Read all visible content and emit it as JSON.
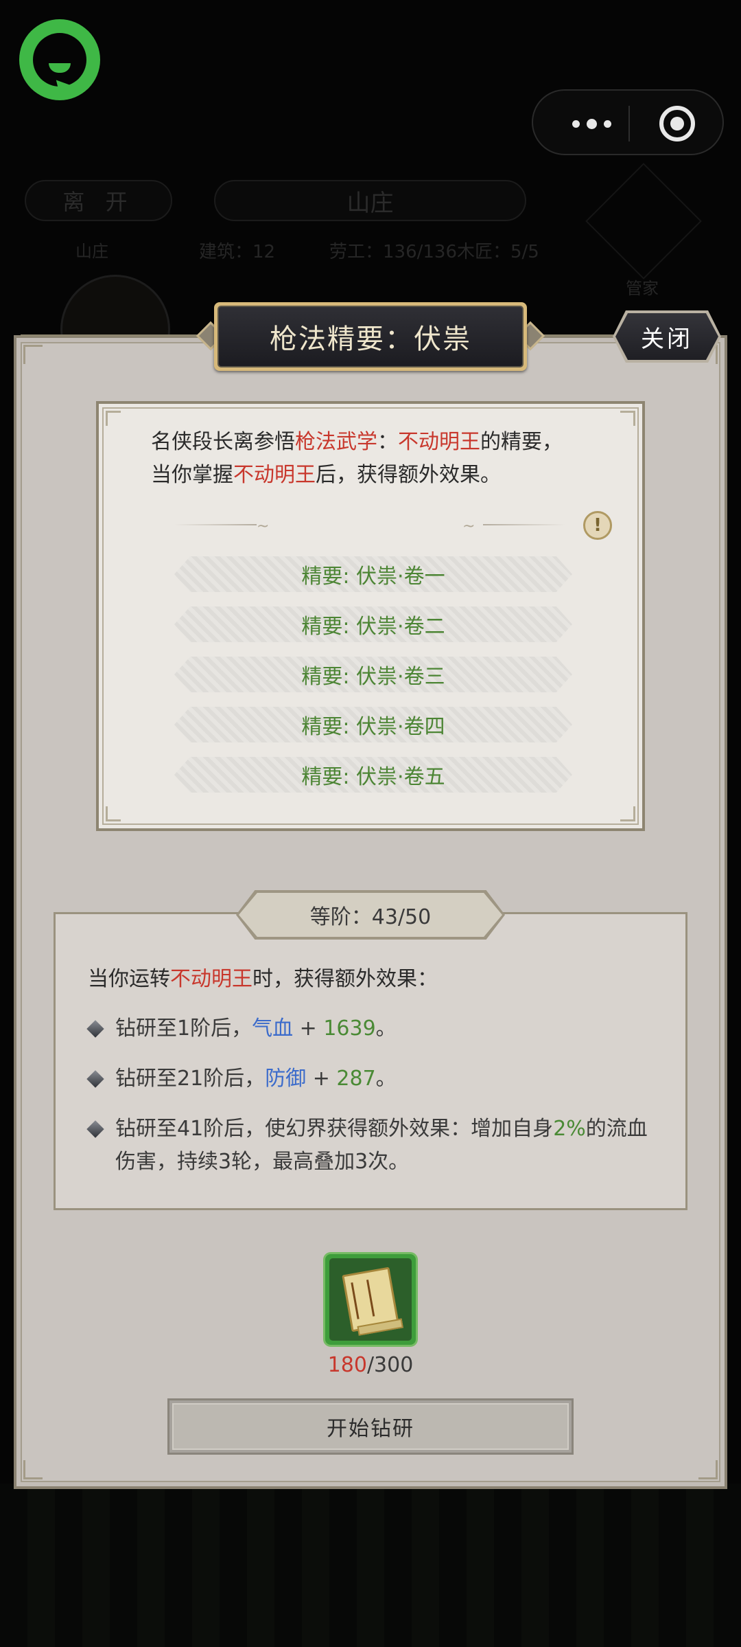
{
  "top": {
    "leave_label": "离 开",
    "manor_label": "山庄",
    "stats": {
      "buildings": "建筑：12",
      "workers": "劳工：136/136",
      "carpenter": "木匠：5/5"
    },
    "steward_label": "管家",
    "left_label": "山庄"
  },
  "dialog": {
    "title": "枪法精要：伏祟",
    "close_label": "关闭"
  },
  "essence": {
    "intro_1": "名侠段长离参悟",
    "intro_2": "枪法武学",
    "intro_3": "：",
    "intro_4": "不动明王",
    "intro_5": "的精要，",
    "intro_6": "当你掌握",
    "intro_7": "不动明王",
    "intro_8": "后，获得额外效果。",
    "volumes": [
      "精要: 伏祟·卷一",
      "精要: 伏祟·卷二",
      "精要: 伏祟·卷三",
      "精要: 伏祟·卷四",
      "精要: 伏祟·卷五"
    ]
  },
  "level": {
    "label": "等阶：43/50",
    "current": 43,
    "max": 50,
    "head_1": "当你运转",
    "head_2": "不动明王",
    "head_3": "时，获得额外效果：",
    "effects": [
      {
        "p1": "钻研至1阶后，",
        "p2": "气血",
        "p3": " + ",
        "p4": "1639",
        "p5": "。"
      },
      {
        "p1": "钻研至21阶后，",
        "p2": "防御",
        "p3": " + ",
        "p4": "287",
        "p5": "。"
      },
      {
        "p1": "钻研至41阶后，使幻界获得额外效果：增加自身",
        "p2": "2%",
        "p3": "的流血伤害，持续3轮，最高叠加3次。"
      }
    ]
  },
  "cost": {
    "have": "180",
    "need": "/300"
  },
  "action": {
    "study_label": "开始钻研"
  },
  "colors": {
    "highlight_red": "#c8372c",
    "highlight_green": "#4a8a35",
    "highlight_blue": "#3b6bcb",
    "item_frame_green": "#3e9d3b"
  }
}
